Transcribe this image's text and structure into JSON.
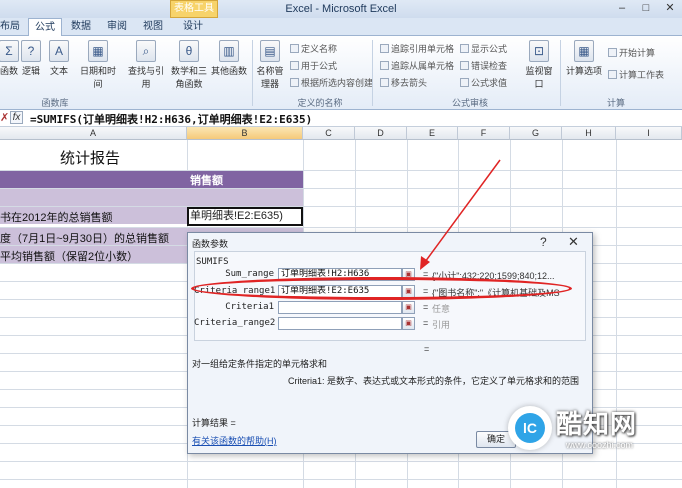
{
  "window": {
    "title": "Excel - Microsoft Excel",
    "context_tab": "表格工具"
  },
  "tabs": [
    "布局",
    "公式",
    "数据",
    "审阅",
    "视图",
    "设计"
  ],
  "ribbon": {
    "function_library": {
      "buttons": [
        "函数",
        "逻辑",
        "文本",
        "日期和时间",
        "查找与引用",
        "数学和三角函数",
        "其他函数"
      ],
      "label": "函数库"
    },
    "defined_names": {
      "manager": "名称管理器",
      "items": [
        "定义名称",
        "用于公式",
        "根据所选内容创建"
      ],
      "label": "定义的名称"
    },
    "formula_auditing": {
      "items": [
        "追踪引用单元格",
        "追踪从属单元格",
        "移去箭头",
        "显示公式",
        "错误检查",
        "公式求值"
      ],
      "watch": "监视窗口",
      "label": "公式审核"
    },
    "calculation": {
      "options": "计算选项",
      "items": [
        "开始计算",
        "计算工作表"
      ],
      "label": "计算"
    }
  },
  "formula_bar": {
    "cancel_icon": "✗",
    "fx": "fx",
    "formula": "=SUMIFS(订单明细表!H2:H636,订单明细表!E2:E635)"
  },
  "columns": [
    "A",
    "B",
    "C",
    "D",
    "E",
    "F",
    "G",
    "H",
    "I"
  ],
  "sheet": {
    "title": "统计报告",
    "header_col_b": "销售额",
    "rows": [
      "书在2012年的总销售额",
      "度（7月1日~9月30日）的总销售额",
      "平均销售额（保留2位小数）"
    ],
    "active_cell_text": "单明细表!E2:E635)"
  },
  "dialog": {
    "title": "函数参数",
    "help": "?",
    "close": "✕",
    "function_name": "SUMIFS",
    "args": [
      {
        "label": "Sum_range",
        "value": "订单明细表!H2:H636",
        "result": "{\"小计\";432;220;1599;840;12..."
      },
      {
        "label": "Criteria_range1",
        "value": "订单明细表!E2:E635",
        "result": "{\"图书名称\";\"《计算机基础及MS"
      },
      {
        "label": "Criteria1",
        "value": "",
        "result": "任意"
      },
      {
        "label": "Criteria_range2",
        "value": "",
        "result": "引用"
      }
    ],
    "eq_middle": "=",
    "description": "对一组给定条件指定的单元格求和",
    "criteria_help": "Criteria1:  是数字、表达式或文本形式的条件，它定义了单元格求和的范围",
    "result_label": "计算结果 =",
    "help_link": "有关该函数的帮助(H)",
    "ok": "确定"
  },
  "watermark": {
    "name": "酷知网",
    "url": "www.coozhi.com"
  },
  "colors": {
    "header_band": "#8064a2",
    "light_band": "#ccc0da",
    "highlight": "#e02424"
  }
}
